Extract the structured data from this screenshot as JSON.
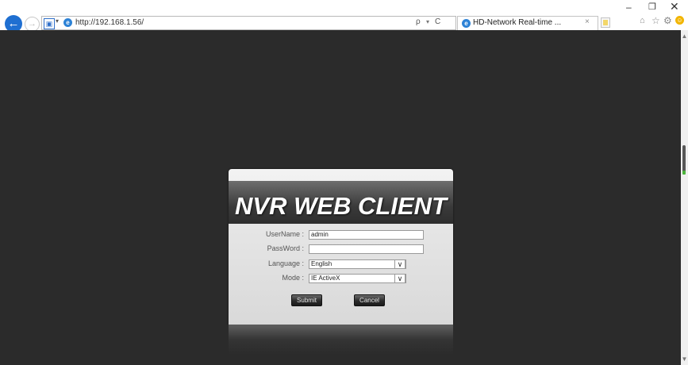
{
  "browser": {
    "back_icon": "←",
    "forward_icon": "→",
    "security_icon": "shield-dropdown-icon",
    "url": "http://192.168.1.56/",
    "search_icon": "ρ",
    "dropdown_glyph": "▾",
    "refresh_icon": "C",
    "tab_title": "HD-Network Real-time ...",
    "tab_close": "×",
    "window": {
      "minimize": "–",
      "restore": "❐",
      "close": "✕"
    },
    "toolbar": {
      "home": "⌂",
      "favorites": "☆",
      "settings": "⚙",
      "feedback": "☺"
    }
  },
  "login": {
    "title": "NVR WEB CLIENT",
    "username_label": "UserName :",
    "username_value": "admin",
    "password_label": "PassWord :",
    "password_value": "",
    "language_label": "Language :",
    "language_value": "English",
    "mode_label": "Mode :",
    "mode_value": "IE ActiveX",
    "submit_label": "Submit",
    "cancel_label": "Cancel"
  },
  "colors": {
    "page_background": "#2b2b2b",
    "panel": "#e5e5e5",
    "banner": "#3a3a3a",
    "accent": "#1f6fd1"
  }
}
